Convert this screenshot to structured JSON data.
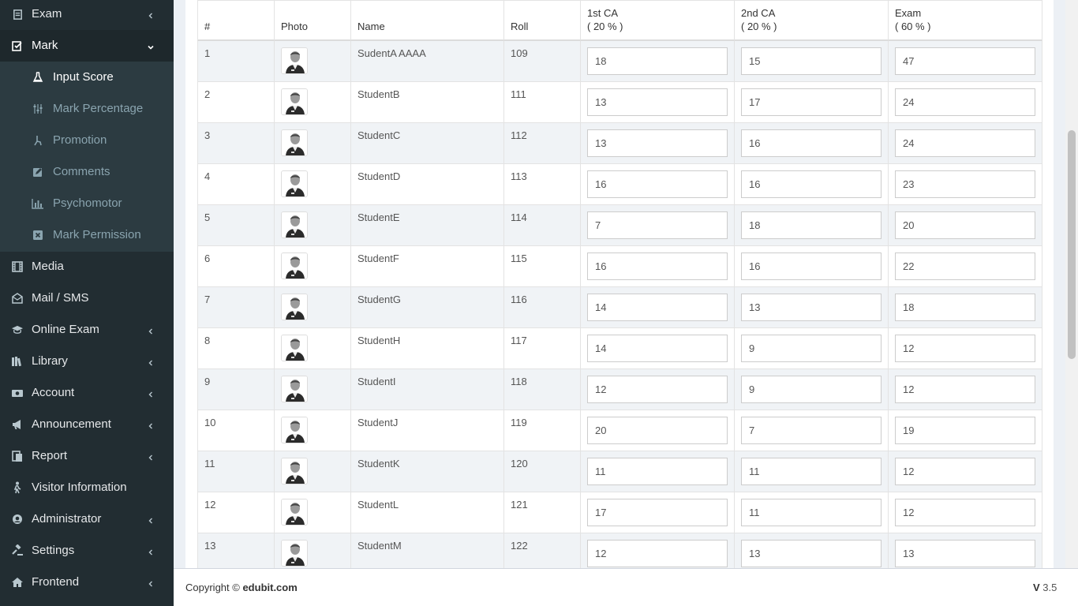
{
  "sidebar": {
    "items": [
      {
        "label": "Exam",
        "icon": "exam-icon",
        "chevron": "left"
      },
      {
        "label": "Mark",
        "icon": "mark-icon",
        "chevron": "down"
      },
      {
        "label": "Media",
        "icon": "film-icon",
        "chevron": ""
      },
      {
        "label": "Mail / SMS",
        "icon": "envelope-icon",
        "chevron": ""
      },
      {
        "label": "Online Exam",
        "icon": "graduation-cap-icon",
        "chevron": "left"
      },
      {
        "label": "Library",
        "icon": "books-icon",
        "chevron": "left"
      },
      {
        "label": "Account",
        "icon": "money-icon",
        "chevron": "left"
      },
      {
        "label": "Announcement",
        "icon": "bullhorn-icon",
        "chevron": "left"
      },
      {
        "label": "Report",
        "icon": "report-icon",
        "chevron": "left"
      },
      {
        "label": "Visitor Information",
        "icon": "walking-person-icon",
        "chevron": ""
      },
      {
        "label": "Administrator",
        "icon": "administrator-icon",
        "chevron": "left"
      },
      {
        "label": "Settings",
        "icon": "gavel-icon",
        "chevron": "left"
      },
      {
        "label": "Frontend",
        "icon": "home-icon",
        "chevron": "left"
      }
    ],
    "mark_submenu": [
      {
        "label": "Input Score",
        "icon": "flask-icon",
        "active": true
      },
      {
        "label": "Mark Percentage",
        "icon": "sliders-icon",
        "active": false
      },
      {
        "label": "Promotion",
        "icon": "promotion-icon",
        "active": false
      },
      {
        "label": "Comments",
        "icon": "edit-icon",
        "active": false
      },
      {
        "label": "Psychomotor",
        "icon": "bar-chart-icon",
        "active": false
      },
      {
        "label": "Mark Permission",
        "icon": "close-box-icon",
        "active": false
      }
    ]
  },
  "table": {
    "headers": {
      "index": "#",
      "photo": "Photo",
      "name": "Name",
      "roll": "Roll",
      "ca1": "1st CA",
      "ca1_pct": "( 20 % )",
      "ca2": "2nd CA",
      "ca2_pct": "( 20 % )",
      "exam": "Exam",
      "exam_pct": "( 60 % )"
    },
    "rows": [
      {
        "num": "1",
        "name": "SudentA AAAA",
        "roll": "109",
        "ca1": "18",
        "ca2": "15",
        "exam": "47"
      },
      {
        "num": "2",
        "name": "StudentB",
        "roll": "111",
        "ca1": "13",
        "ca2": "17",
        "exam": "24"
      },
      {
        "num": "3",
        "name": "StudentC",
        "roll": "112",
        "ca1": "13",
        "ca2": "16",
        "exam": "24"
      },
      {
        "num": "4",
        "name": "StudentD",
        "roll": "113",
        "ca1": "16",
        "ca2": "16",
        "exam": "23"
      },
      {
        "num": "5",
        "name": "StudentE",
        "roll": "114",
        "ca1": "7",
        "ca2": "18",
        "exam": "20"
      },
      {
        "num": "6",
        "name": "StudentF",
        "roll": "115",
        "ca1": "16",
        "ca2": "16",
        "exam": "22"
      },
      {
        "num": "7",
        "name": "StudentG",
        "roll": "116",
        "ca1": "14",
        "ca2": "13",
        "exam": "18"
      },
      {
        "num": "8",
        "name": "StudentH",
        "roll": "117",
        "ca1": "14",
        "ca2": "9",
        "exam": "12"
      },
      {
        "num": "9",
        "name": "StudentI",
        "roll": "118",
        "ca1": "12",
        "ca2": "9",
        "exam": "12"
      },
      {
        "num": "10",
        "name": "StudentJ",
        "roll": "119",
        "ca1": "20",
        "ca2": "7",
        "exam": "19"
      },
      {
        "num": "11",
        "name": "StudentK",
        "roll": "120",
        "ca1": "11",
        "ca2": "11",
        "exam": "12"
      },
      {
        "num": "12",
        "name": "StudentL",
        "roll": "121",
        "ca1": "17",
        "ca2": "11",
        "exam": "12"
      },
      {
        "num": "13",
        "name": "StudentM",
        "roll": "122",
        "ca1": "12",
        "ca2": "13",
        "exam": "13"
      }
    ]
  },
  "footer": {
    "copyright_prefix": "Copyright © ",
    "copyright_brand": "edubit.com",
    "version_prefix": "V",
    "version_number": "3.5"
  },
  "colors": {
    "sidebar_bg": "#222d32",
    "submenu_bg": "#2c3b41",
    "row_stripe": "#f0f3f6"
  }
}
